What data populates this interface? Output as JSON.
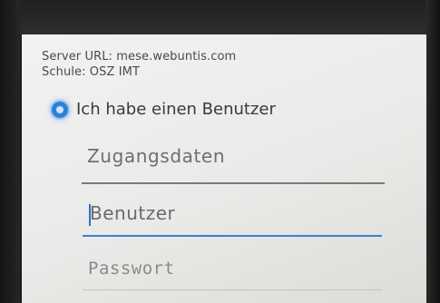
{
  "server": {
    "url_line": "Server URL: mese.webuntis.com",
    "school_line": "Schule: OSZ IMT"
  },
  "login_option": {
    "label": "Ich habe einen Benutzer",
    "selected": true
  },
  "credentials": {
    "section_title": "Zugangsdaten",
    "username_placeholder": "Benutzer",
    "password_placeholder": "Passwort"
  },
  "colors": {
    "accent": "#2f7fd8",
    "background": "#f0f0ee"
  }
}
